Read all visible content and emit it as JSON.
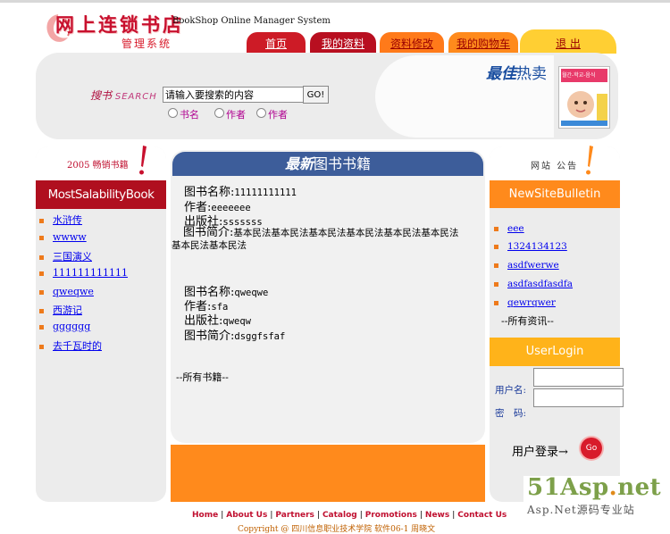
{
  "header": {
    "logo_cn": "网上连锁书店",
    "logo_sub": "管理系统",
    "logo_en": "BookShop Online Manager System"
  },
  "nav": {
    "tabs": [
      "首页",
      "我的资料",
      "资料修改",
      "我的购物车",
      "退 出"
    ]
  },
  "search": {
    "label_cn": "搜书",
    "label_en": "SEARCH",
    "input_value": "请输入要搜索的内容",
    "go_label": "GO!",
    "options": [
      "书名",
      "作者",
      "作者"
    ]
  },
  "hot": {
    "title_strong": "最佳",
    "title_rest": "热卖",
    "cover_text": "월간-학교-음식"
  },
  "left": {
    "header": "2005 畅销书籍",
    "banner": "MostSalabilityBook",
    "items": [
      "水浒传",
      "wwww",
      "三国演义",
      "111111111111",
      "qweqwe",
      "西游记",
      "gggggg",
      "去千瓦时的"
    ]
  },
  "center": {
    "title_strong": "最新",
    "title_rest": "图书书籍",
    "books": [
      {
        "name_label": "图书名称:",
        "name": "11111111111",
        "author_label": "作者:",
        "author": "eeeeeee",
        "publisher_label": "出版社:",
        "publisher": "sssssss",
        "intro_label": "图书简介:",
        "intro": "基本民法基本民法基本民法基本民法基本民法基本民法基本民法基本民法"
      },
      {
        "name_label": "图书名称:",
        "name": "qweqwe",
        "author_label": "作者:",
        "author": "sfa",
        "publisher_label": "出版社:",
        "publisher": "qweqw",
        "intro_label": "图书简介:",
        "intro": "dsggfsfaf"
      }
    ],
    "all_books": "--所有书籍--"
  },
  "right": {
    "header": "网站 公告",
    "banner": "NewSiteBulletin",
    "items": [
      "eee",
      "1324134123",
      "asdfwerwe",
      "asdfasdfasdfa",
      "qewrqwer"
    ],
    "all_info": "--所有资讯--",
    "login_banner": "UserLogin",
    "username_label": "用户名:",
    "password_label": "密　码:",
    "login_text": "用户登录→",
    "go_text": "Go"
  },
  "footer": {
    "links": [
      "Home",
      "About Us",
      "Partners",
      "Catalog",
      "Promotions",
      "News",
      "Contact Us"
    ],
    "copyright": "Copyright @ 四川信息职业技术学院  软件06-1  周晓文"
  },
  "watermark": {
    "big_part1": "51Asp",
    "big_dot": ".",
    "big_part2": "net",
    "small": "Asp.Net源码专业站"
  },
  "colors": {
    "red": "#c8102e",
    "orange": "#ff8a1c",
    "blue": "#3d5d9a",
    "panel": "#ececec"
  }
}
